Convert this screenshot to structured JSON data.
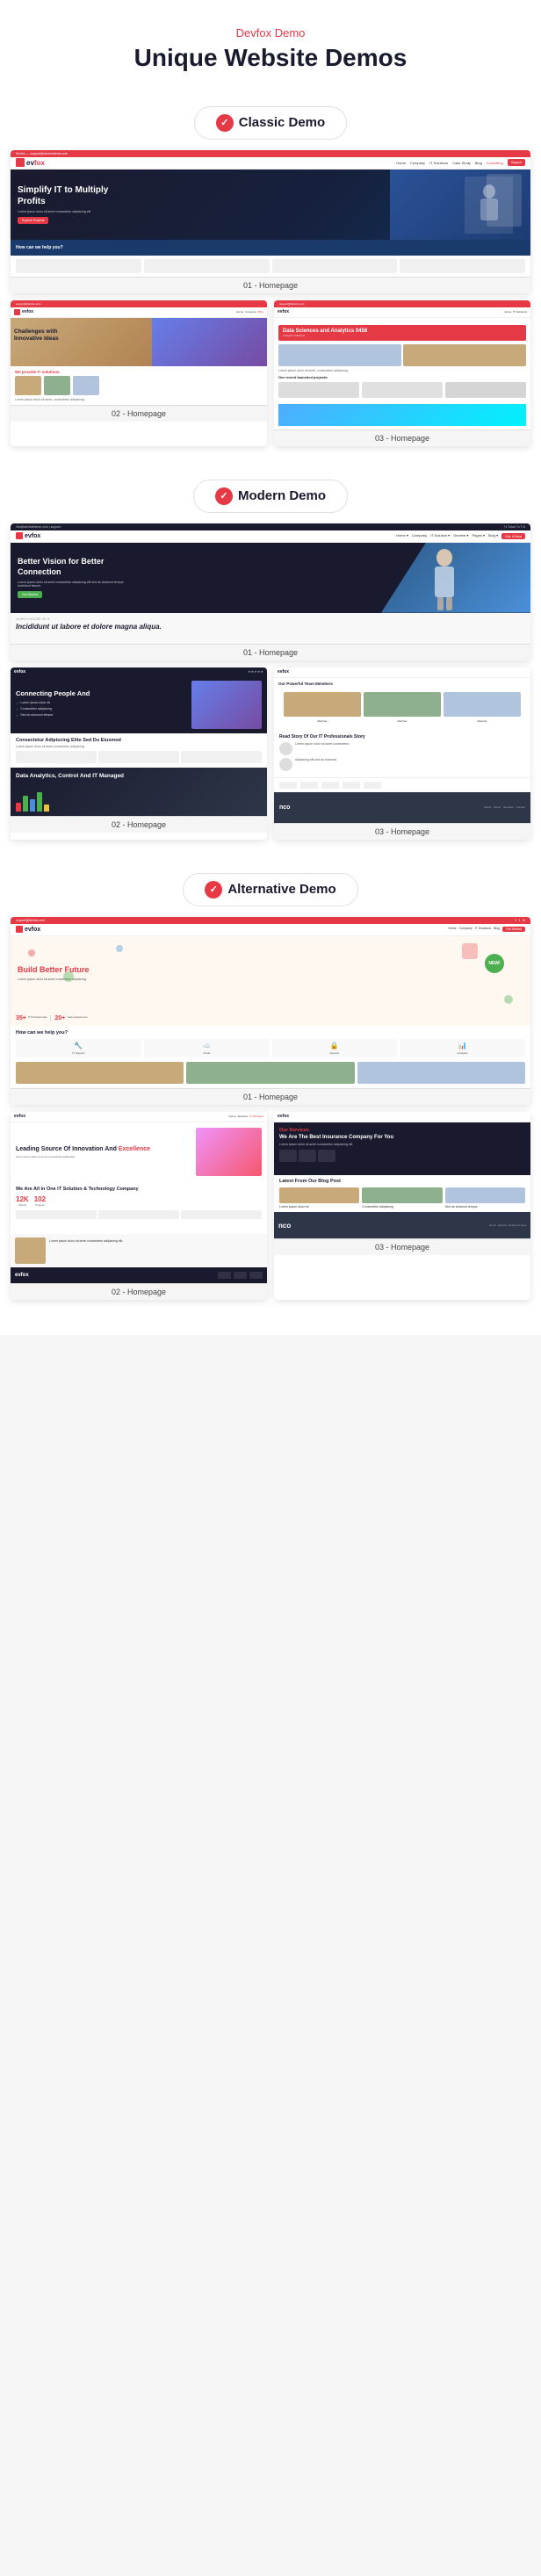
{
  "header": {
    "bg_text": "Devfox",
    "subtitle": "Devfox Demo",
    "title": "Unique Website Demos"
  },
  "classic_demo": {
    "label": "Classic Demo",
    "homepage_01": {
      "nav": {
        "logo": "evfox",
        "links": [
          "Home",
          "Company",
          "IT Solutions",
          "Case Study",
          "Blog",
          "Consulting"
        ],
        "cta": "Support Engineer"
      },
      "hero": {
        "heading": "Simplify IT to Multiply Profits",
        "subtext": "Lorem ipsum dolor sit amet consectetur adipiscing elit",
        "btn": "Explore Projects"
      },
      "blue_bar": "How can we help you?",
      "caption": "01 - Homepage"
    },
    "homepage_02": {
      "overlay_text": "Challenges with Innovative Ideas",
      "section_label": "We provide IT solutions",
      "lorem": "Lorem ipsum dolor sit amet, consectetur adipiscing.",
      "caption": "02 - Homepage"
    },
    "homepage_03": {
      "card_title": "Data Sciences and Analytics 0458",
      "lorem": "Lorem ipsum dolor sit amet, consectetur adipiscing.",
      "recent": "Our recent launched projects",
      "caption": "03 - Homepage"
    }
  },
  "modern_demo": {
    "label": "Modern Demo",
    "homepage_01": {
      "hero_heading": "Better Vision for Better Connection",
      "hero_sub": "Lorem ipsum dolor sit amet consectetur adipiscing elit sed do eiusmod tempor incididunt laboris",
      "hero_btn": "Get Started",
      "incididunt_text": "Incididunt ut labore et dolore magna aliqua.",
      "caption": "01 - Homepage"
    },
    "homepage_02": {
      "connecting_text": "Connecting People And",
      "consectetur": "Consectetur Adipiscing Elite Sed Du Eiusmod",
      "analytics_text": "Data Analytics, Control And IT Managed",
      "caption": "02 - Homepage"
    },
    "homepage_03": {
      "team_heading": "Our Powerful Team Members",
      "read_story": "Read Story Of Our IT Professionals Story",
      "caption": "03 - Homepage"
    }
  },
  "alternative_demo": {
    "label": "Alternative Demo",
    "homepage_01": {
      "hero_heading": "Build Better Future",
      "stats_35": "35+",
      "stats_label": "IT Professionals",
      "how_help": "How can we help you?",
      "caption": "01 - Homepage"
    },
    "homepage_02": {
      "leading_text": "Leading Source Of Innovation And Excellence",
      "it_solution": "We Are All in One IT Solution & Technology Company",
      "counter_12k": "12K",
      "counter_102": "102",
      "caption": "02 - Homepage"
    },
    "homepage_03": {
      "insurance_heading": "We Are The Best Insurance Company For You",
      "latest_blog": "Latest From Our Blog Post",
      "caption": "03 - Homepage"
    }
  }
}
